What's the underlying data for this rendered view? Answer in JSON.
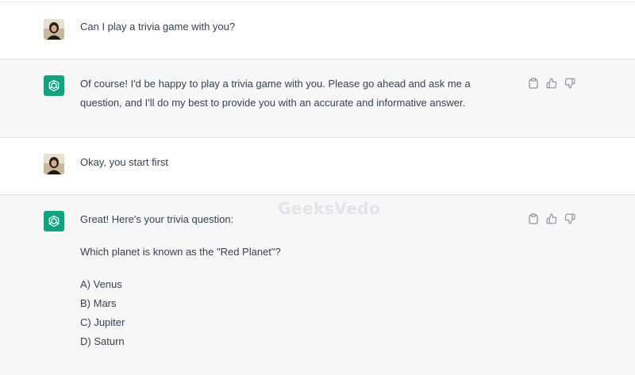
{
  "watermark": "GeeksVedo",
  "conversation": [
    {
      "role": "user",
      "text": "Can I play a trivia game with you?"
    },
    {
      "role": "assistant",
      "paragraphs": [
        "Of course! I'd be happy to play a trivia game with you. Please go ahead and ask me a question, and I'll do my best to provide you with an accurate and informative answer."
      ]
    },
    {
      "role": "user",
      "text": "Okay, you start first"
    },
    {
      "role": "assistant",
      "intro": "Great! Here's your trivia question:",
      "question": "Which planet is known as the \"Red Planet\"?",
      "options": [
        "A) Venus",
        "B) Mars",
        "C) Jupiter",
        "D) Saturn"
      ]
    }
  ],
  "message_actions": [
    "copy-icon",
    "thumbs-up-icon",
    "thumbs-down-icon"
  ],
  "colors": {
    "assistant_bg": "#f7f7f8",
    "user_bg": "#ffffff",
    "brand": "#10a37f",
    "text": "#374151"
  }
}
